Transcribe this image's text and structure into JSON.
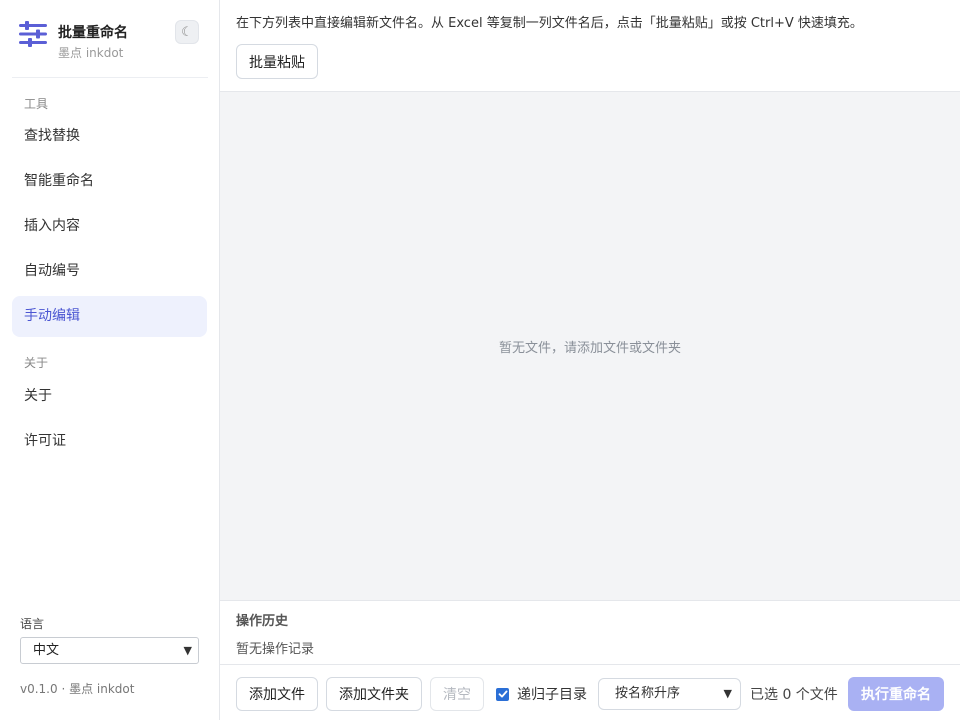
{
  "app": {
    "title": "批量重命名",
    "subtitle": "墨点 inkdot",
    "collapse_icon": "☾",
    "logo_icon": "sliders-icon",
    "accent_color": "#4b56d2"
  },
  "sidebar": {
    "sections": [
      {
        "label": "工具",
        "items": [
          {
            "label": "查找替换"
          },
          {
            "label": "智能重命名"
          },
          {
            "label": "插入内容"
          },
          {
            "label": "自动编号"
          },
          {
            "label": "手动编辑",
            "active": true
          }
        ]
      },
      {
        "label": "关于",
        "items": [
          {
            "label": "关于"
          },
          {
            "label": "许可证"
          }
        ]
      }
    ],
    "language_label": "语言",
    "language_value": "中文",
    "version": "v0.1.0 · 墨点 inkdot"
  },
  "main": {
    "hint": "在下方列表中直接编辑新文件名。从 Excel 等复制一列文件名后，点击「批量粘贴」或按 Ctrl+V 快速填充。",
    "paste_button": "批量粘贴",
    "empty_message": "暂无文件，请添加文件或文件夹",
    "history_title": "操作历史",
    "history_empty": "暂无操作记录"
  },
  "toolbar": {
    "add_file": "添加文件",
    "add_folder": "添加文件夹",
    "clear": "清空",
    "recursive_label": "递归子目录",
    "recursive_checked": true,
    "sort_value": "按名称升序",
    "selected_count": "已选 0 个文件",
    "run_button": "执行重命名",
    "run_color": "#a9b1f3"
  }
}
